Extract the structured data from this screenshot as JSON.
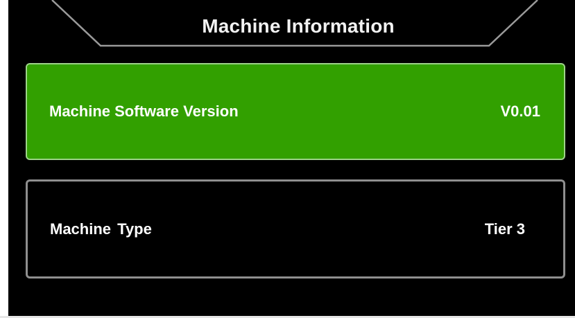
{
  "header": {
    "title": "Machine Information"
  },
  "rows": [
    {
      "label": "Machine Software Version",
      "value": "V0.01",
      "selected": true,
      "color": "#32a000"
    },
    {
      "label": "Machine  Type",
      "value": "Tier 3",
      "selected": false
    }
  ]
}
